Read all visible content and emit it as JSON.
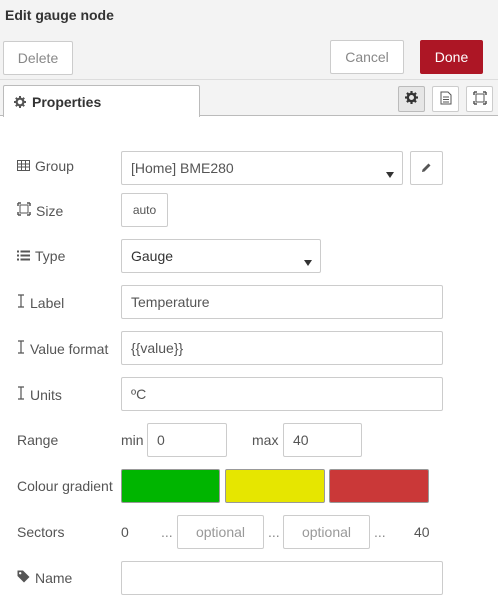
{
  "dialog": {
    "title": "Edit gauge node",
    "delete_label": "Delete",
    "cancel_label": "Cancel",
    "done_label": "Done"
  },
  "tabs": {
    "properties_label": "Properties",
    "side_icons": [
      "gear-icon",
      "description-icon",
      "appearance-icon"
    ]
  },
  "form": {
    "group": {
      "label": "Group",
      "value": "[Home] BME280"
    },
    "size": {
      "label": "Size",
      "value": "auto"
    },
    "type": {
      "label": "Type",
      "value": "Gauge"
    },
    "label": {
      "label": "Label",
      "value": "Temperature"
    },
    "value_format": {
      "label": "Value format",
      "value": "{{value}}"
    },
    "units": {
      "label": "Units",
      "value": "ºC"
    },
    "range": {
      "label": "Range",
      "min_label": "min",
      "min_value": "0",
      "max_label": "max",
      "max_value": "40"
    },
    "colour_gradient": {
      "label": "Colour gradient",
      "colors": [
        "#00b500",
        "#e6e600",
        "#ca3838"
      ]
    },
    "sectors": {
      "label": "Sectors",
      "start": "0",
      "dots": "...",
      "placeholder": "optional",
      "end": "40"
    },
    "name": {
      "label": "Name",
      "value": ""
    }
  },
  "colors": {
    "accent": "#ad1625",
    "header_bg": "#f3f3f3"
  }
}
